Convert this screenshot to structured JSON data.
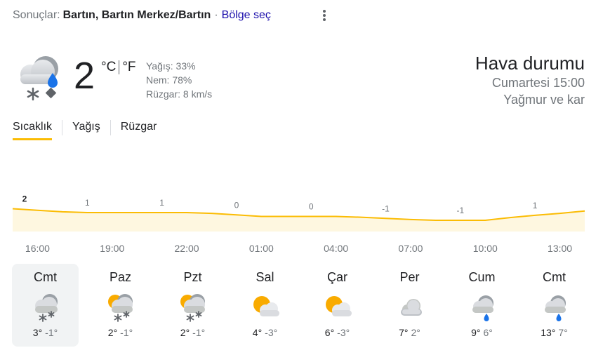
{
  "header": {
    "prefix": "Sonuçlar:",
    "location": "Bartın, Bartın Merkez/Bartın",
    "separator": "·",
    "region_link": "Bölge seç"
  },
  "current": {
    "temperature": "2",
    "unit_c": "°C",
    "unit_f": "°F",
    "precipitation": "Yağış: 33%",
    "humidity": "Nem: 78%",
    "wind": "Rüzgar: 8 km/s",
    "icon": "rain-snow-icon"
  },
  "summary": {
    "title": "Hava durumu",
    "datetime": "Cumartesi 15:00",
    "condition": "Yağmur ve kar"
  },
  "tabs": [
    {
      "label": "Sıcaklık",
      "active": true
    },
    {
      "label": "Yağış",
      "active": false
    },
    {
      "label": "Rüzgar",
      "active": false
    }
  ],
  "chart_data": {
    "type": "area",
    "x": [
      "15:00",
      "16:00",
      "17:00",
      "18:00",
      "19:00",
      "20:00",
      "21:00",
      "22:00",
      "23:00",
      "00:00",
      "01:00",
      "02:00",
      "03:00",
      "04:00",
      "05:00",
      "06:00",
      "07:00",
      "08:00",
      "09:00",
      "10:00",
      "11:00",
      "12:00",
      "13:00",
      "14:00"
    ],
    "values": [
      2,
      1.6,
      1.2,
      1,
      1,
      1,
      1,
      1,
      0.8,
      0.4,
      0,
      0,
      0,
      0,
      -0.2,
      -0.5,
      -0.8,
      -1,
      -1,
      -1,
      -0.3,
      0.3,
      0.8,
      1.4
    ],
    "labeled_points": [
      {
        "x_index": 0,
        "label": "2"
      },
      {
        "x_index": 3,
        "label": "1"
      },
      {
        "x_index": 6,
        "label": "1"
      },
      {
        "x_index": 9,
        "label": "0"
      },
      {
        "x_index": 12,
        "label": "0"
      },
      {
        "x_index": 15,
        "label": "-1"
      },
      {
        "x_index": 18,
        "label": "-1"
      },
      {
        "x_index": 21,
        "label": "1"
      }
    ],
    "hour_labels": [
      "16:00",
      "19:00",
      "22:00",
      "01:00",
      "04:00",
      "07:00",
      "10:00",
      "13:00"
    ],
    "line_color": "#fbbc04",
    "fill_color": "#fef7e0",
    "grid": false
  },
  "forecast": [
    {
      "day": "Cmt",
      "hi": "3°",
      "lo": "-1°",
      "icon": "snow-cloud-icon",
      "active": true
    },
    {
      "day": "Paz",
      "hi": "2°",
      "lo": "-1°",
      "icon": "partly-cloudy-snow-icon",
      "active": false
    },
    {
      "day": "Pzt",
      "hi": "2°",
      "lo": "-1°",
      "icon": "partly-cloudy-snow-icon",
      "active": false
    },
    {
      "day": "Sal",
      "hi": "4°",
      "lo": "-3°",
      "icon": "partly-cloudy-icon",
      "active": false
    },
    {
      "day": "Çar",
      "hi": "6°",
      "lo": "-3°",
      "icon": "partly-cloudy-icon",
      "active": false
    },
    {
      "day": "Per",
      "hi": "7°",
      "lo": "2°",
      "icon": "cloudy-icon",
      "active": false
    },
    {
      "day": "Cum",
      "hi": "9°",
      "lo": "6°",
      "icon": "rain-cloud-icon",
      "active": false
    },
    {
      "day": "Cmt",
      "hi": "13°",
      "lo": "7°",
      "icon": "rain-cloud-icon",
      "active": false
    }
  ]
}
